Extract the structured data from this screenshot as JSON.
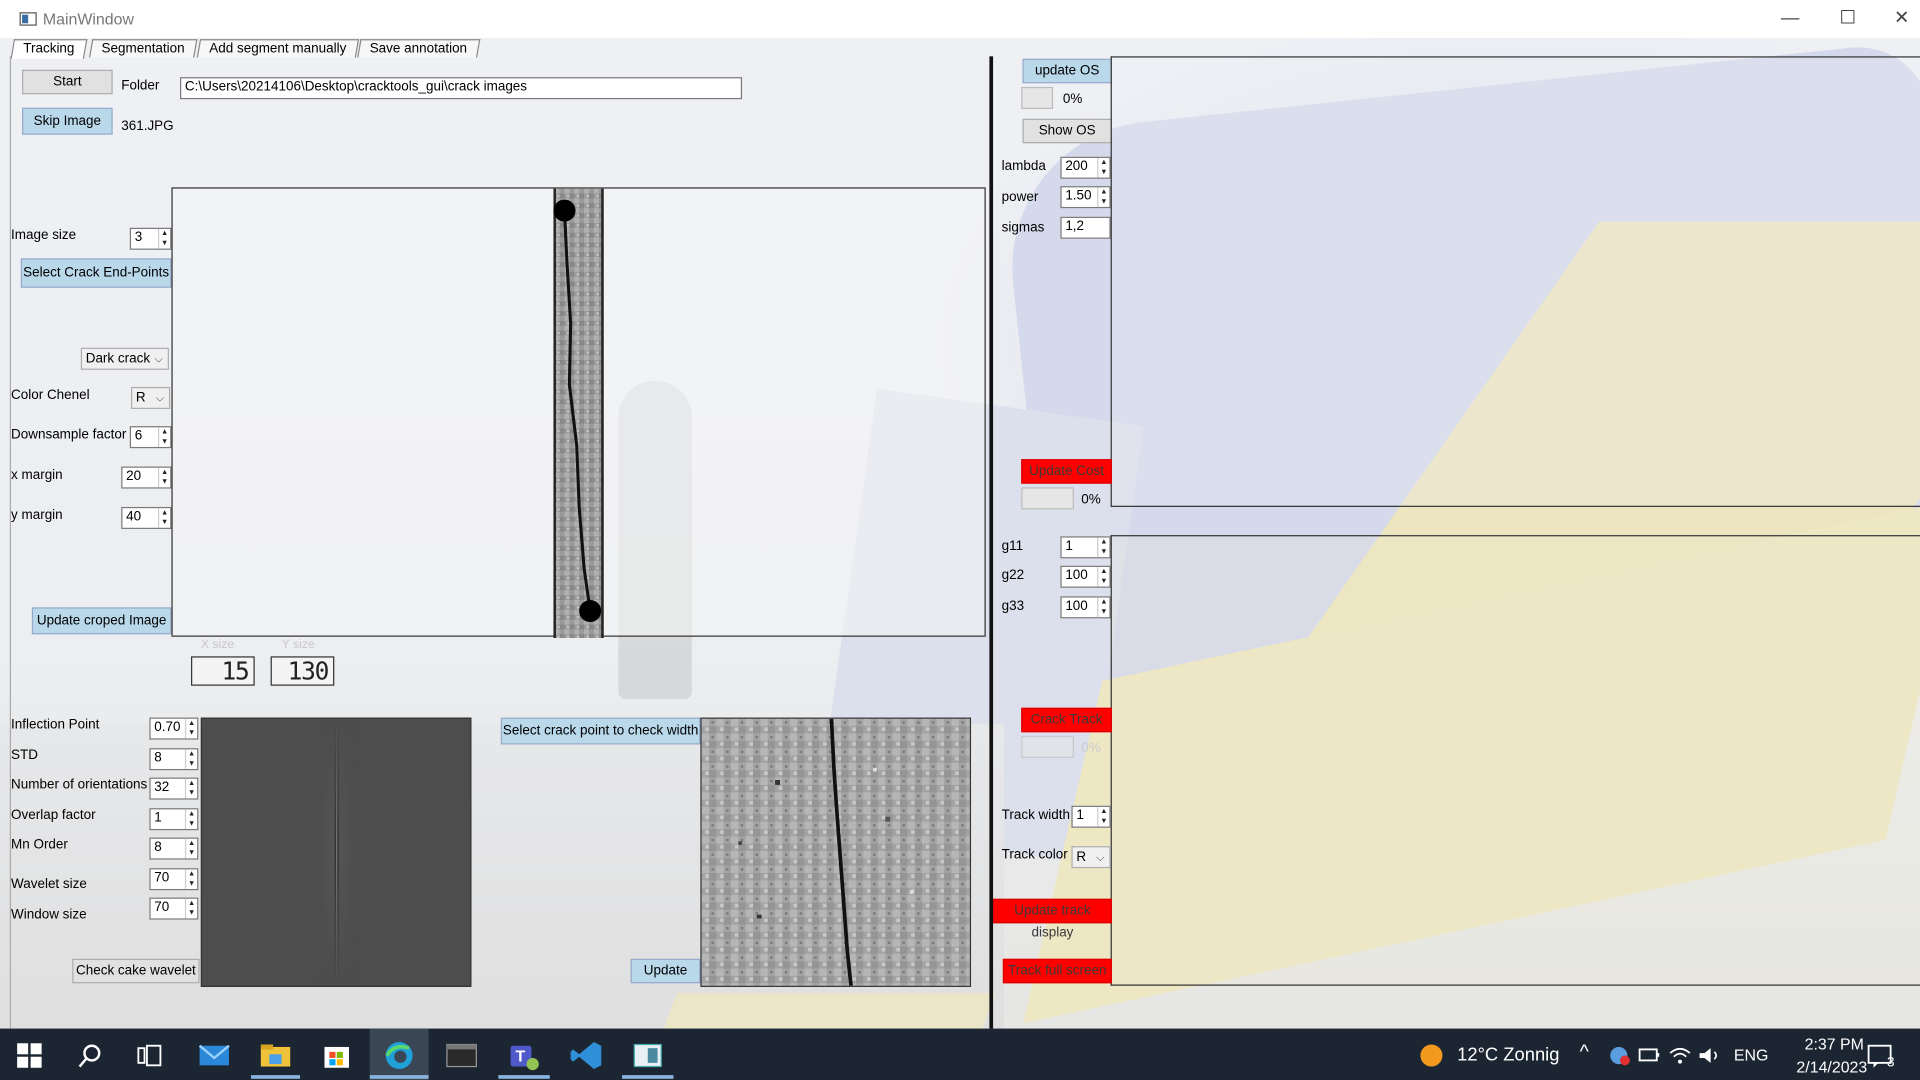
{
  "window": {
    "title": "MainWindow",
    "minimize": "—",
    "maximize": "☐",
    "close": "✕"
  },
  "tabs": [
    "Tracking",
    "Segmentation",
    "Add segment manually",
    "Save annotation"
  ],
  "left": {
    "start_label": "Start",
    "folder_label": "Folder",
    "folder_value": "C:\\Users\\20214106\\Desktop\\cracktools_gui\\crack images",
    "skip_label": "Skip Image",
    "filename": "361.JPG",
    "image_size_label": "Image size",
    "image_size_value": "3",
    "select_endpoints_label": "Select Crack End-Points",
    "crack_type": "Dark crack",
    "color_channel_label": "Color Chenel",
    "color_channel_value": "R",
    "downsample_label": "Downsample factor",
    "downsample_value": "6",
    "x_margin_label": "x margin",
    "x_margin_value": "20",
    "y_margin_label": "y margin",
    "y_margin_value": "40",
    "update_cropped_label": "Update croped Image",
    "x_size_caption": "X size",
    "y_size_caption": "Y size",
    "x_size_value": "15",
    "y_size_value": "130",
    "inflection_label": "Inflection Point",
    "inflection_value": "0.70",
    "std_label": "STD",
    "std_value": "8",
    "orientations_label": "Number of orientations",
    "orientations_value": "32",
    "overlap_label": "Overlap factor",
    "overlap_value": "1",
    "mn_order_label": "Mn Order",
    "mn_order_value": "8",
    "wavelet_size_label": "Wavelet size",
    "wavelet_size_value": "70",
    "window_size_label": "Window size",
    "window_size_value": "70",
    "check_cake_label": "Check cake wavelet",
    "select_width_label": "Select crack point to check width",
    "update_label": "Update"
  },
  "right": {
    "update_os_label": "update OS",
    "os_progress_text": "0%",
    "show_os_label": "Show OS",
    "lambda_label": "lambda",
    "lambda_value": "200",
    "power_label": "power",
    "power_value": "1.50",
    "sigmas_label": "sigmas",
    "sigmas_value": "1,2",
    "update_cost_label": "Update Cost",
    "cost_progress_text": "0%",
    "g11_label": "g11",
    "g11_value": "1",
    "g22_label": "g22",
    "g22_value": "100",
    "g33_label": "g33",
    "g33_value": "100",
    "crack_track_label": "Crack Track",
    "track_progress_text": "0%",
    "track_width_label": "Track width",
    "track_width_value": "1",
    "track_color_label": "Track color",
    "track_color_value": "R",
    "update_track_label": "Update track display",
    "track_full_label": "Track full screen"
  },
  "taskbar": {
    "weather": "12°C Zonnig",
    "lang": "ENG",
    "time": "2:37 PM",
    "date": "2/14/2023",
    "notifications": "3"
  },
  "colors": {
    "accent_blue": "#b9d8ea",
    "alert_red": "#ff0000",
    "taskbar": "#1c2633"
  }
}
